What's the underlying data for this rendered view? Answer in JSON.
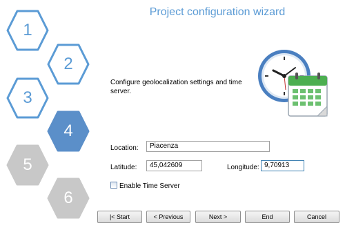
{
  "wizard": {
    "title": "Project configuration wizard",
    "steps": [
      {
        "label": "1",
        "state": "done"
      },
      {
        "label": "2",
        "state": "done"
      },
      {
        "label": "3",
        "state": "done"
      },
      {
        "label": "4",
        "state": "current"
      },
      {
        "label": "5",
        "state": "pending"
      },
      {
        "label": "6",
        "state": "pending"
      }
    ]
  },
  "content": {
    "description": "Configure geolocalization settings and time server.",
    "icon": "clock-calendar-icon"
  },
  "form": {
    "location_label": "Location:",
    "location_value": "Piacenza",
    "latitude_label": "Latitude:",
    "latitude_value": "45,042609",
    "longitude_label": "Longitude:",
    "longitude_value": "9,70913",
    "time_server_label": "Enable Time Server",
    "time_server_checked": false
  },
  "buttons": {
    "start": "|< Start",
    "previous": "< Previous",
    "next": "Next >",
    "end": "End",
    "cancel": "Cancel"
  },
  "colors": {
    "done": "#5b9bd5",
    "current_fill": "#5b8fc9",
    "pending_fill": "#c8c8c8"
  }
}
